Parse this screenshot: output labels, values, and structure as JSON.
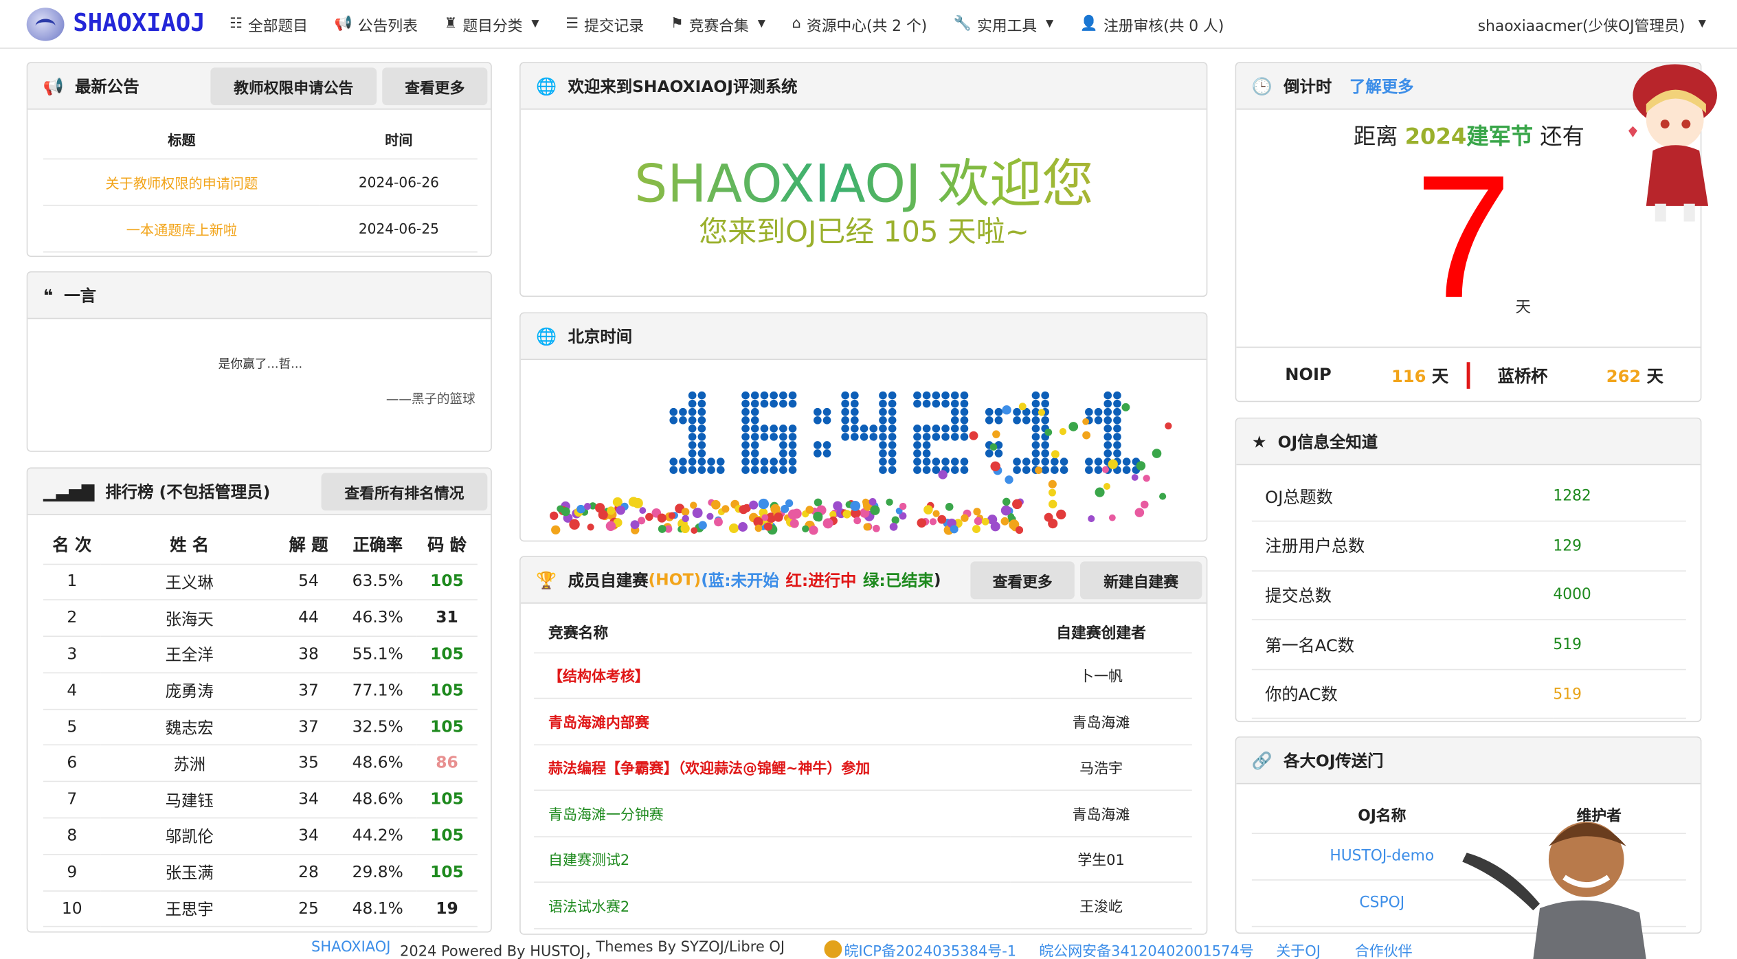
{
  "nav": {
    "logo_text": "SHAOXIAOJ",
    "items": [
      {
        "label": "全部题目",
        "icon": "list-icon",
        "dropdown": false
      },
      {
        "label": "公告列表",
        "icon": "bullhorn-icon",
        "dropdown": false
      },
      {
        "label": "题目分类",
        "icon": "bag-icon",
        "dropdown": true
      },
      {
        "label": "提交记录",
        "icon": "tasks-icon",
        "dropdown": false
      },
      {
        "label": "竞赛合集",
        "icon": "flag-icon",
        "dropdown": true
      },
      {
        "label": "资源中心(共 2 个)",
        "icon": "inbox-icon",
        "dropdown": false
      },
      {
        "label": "实用工具",
        "icon": "wrench-icon",
        "dropdown": true
      },
      {
        "label": "注册审核(共 0 人)",
        "icon": "user-icon",
        "dropdown": false
      }
    ],
    "user": "shaoxiaacmer(少侠OJ管理员)"
  },
  "announcements": {
    "title": "最新公告",
    "btn_teacher": "教师权限申请公告",
    "btn_more": "查看更多",
    "col_title": "标题",
    "col_time": "时间",
    "rows": [
      {
        "title": "关于教师权限的申请问题",
        "time": "2024-06-26"
      },
      {
        "title": "一本通题库上新啦",
        "time": "2024-06-25"
      }
    ]
  },
  "quote": {
    "title": "一言",
    "text": "是你赢了...哲...",
    "source": "——黑子的篮球"
  },
  "ranking": {
    "title": "排行榜 (不包括管理员)",
    "btn_all": "查看所有排名情况",
    "headers": [
      "名 次",
      "姓 名",
      "解 题",
      "正确率",
      "码 龄"
    ],
    "rows": [
      {
        "rank": "1",
        "name": "王义琳",
        "solved": "54",
        "rate": "63.5%",
        "age": "105",
        "age_color": "#1e8a1e"
      },
      {
        "rank": "2",
        "name": "张海天",
        "solved": "44",
        "rate": "46.3%",
        "age": "31",
        "age_color": "#222222"
      },
      {
        "rank": "3",
        "name": "王全洋",
        "solved": "38",
        "rate": "55.1%",
        "age": "105",
        "age_color": "#1e8a1e"
      },
      {
        "rank": "4",
        "name": "庞勇涛",
        "solved": "37",
        "rate": "77.1%",
        "age": "105",
        "age_color": "#1e8a1e"
      },
      {
        "rank": "5",
        "name": "魏志宏",
        "solved": "37",
        "rate": "32.5%",
        "age": "105",
        "age_color": "#1e8a1e"
      },
      {
        "rank": "6",
        "name": "苏洲",
        "solved": "35",
        "rate": "48.6%",
        "age": "86",
        "age_color": "#e89090"
      },
      {
        "rank": "7",
        "name": "马建钰",
        "solved": "34",
        "rate": "48.6%",
        "age": "105",
        "age_color": "#1e8a1e"
      },
      {
        "rank": "8",
        "name": "邬凯伦",
        "solved": "34",
        "rate": "44.2%",
        "age": "105",
        "age_color": "#1e8a1e"
      },
      {
        "rank": "9",
        "name": "张玉满",
        "solved": "28",
        "rate": "29.8%",
        "age": "105",
        "age_color": "#1e8a1e"
      },
      {
        "rank": "10",
        "name": "王思宇",
        "solved": "25",
        "rate": "48.1%",
        "age": "19",
        "age_color": "#222222"
      }
    ]
  },
  "welcome": {
    "title": "欢迎来到SHAOXIAOJ评测系统",
    "line1": "SHAOXIAOJ 欢迎您",
    "line2": "您来到OJ已经 105 天啦~"
  },
  "clock": {
    "title": "北京时间",
    "time": "16:42:11"
  },
  "contests": {
    "title_main": "成员自建赛",
    "title_hot": "(HOT)",
    "legend_open": "(",
    "legend_blue": "蓝:未开始",
    "legend_red": "红:进行中",
    "legend_green": "绿:已结束",
    "legend_close": ")",
    "btn_more": "查看更多",
    "btn_new": "新建自建赛",
    "col_name": "竞赛名称",
    "col_creator": "自建赛创建者",
    "rows": [
      {
        "name": "【结构体考核】",
        "creator": "卜一帆",
        "color": "#e01818"
      },
      {
        "name": "青岛海滩内部赛",
        "creator": "青岛海滩",
        "color": "#e01818"
      },
      {
        "name": "蒜法编程【争霸赛】（欢迎蒜法@锦鲤~神牛）参加",
        "creator": "马浩宇",
        "color": "#e01818"
      },
      {
        "name": "青岛海滩一分钟赛",
        "creator": "青岛海滩",
        "color": "#1e8a1e"
      },
      {
        "name": "自建赛测试2",
        "creator": "学生01",
        "color": "#1e8a1e"
      },
      {
        "name": "语法试水赛2",
        "creator": "王浚屹",
        "color": "#1e8a1e"
      }
    ]
  },
  "countdown": {
    "title": "倒计时",
    "learn_more": "了解更多",
    "prefix": "距离",
    "event_year": "2024",
    "event_name": "建军节",
    "suffix": "还有",
    "days": "7",
    "unit": "天",
    "noip_label": "NOIP",
    "noip_days": "116",
    "lanqiao_label": "蓝桥杯",
    "lanqiao_days": "262",
    "day_word": "天"
  },
  "info": {
    "title": "OJ信息全知道",
    "rows": [
      {
        "label": "OJ总题数",
        "value": "1282",
        "color": "#1e8a1e"
      },
      {
        "label": "注册用户总数",
        "value": "129",
        "color": "#1e8a1e"
      },
      {
        "label": "提交总数",
        "value": "4000",
        "color": "#1e8a1e"
      },
      {
        "label": "第一名AC数",
        "value": "519",
        "color": "#1e8a1e"
      },
      {
        "label": "你的AC数",
        "value": "519",
        "color": "#e8a317"
      }
    ]
  },
  "portal": {
    "title": "各大OJ传送门",
    "col_name": "OJ名称",
    "col_maint": "维护者",
    "rows": [
      {
        "name": "HUSTOJ-demo"
      },
      {
        "name": "CSPOJ"
      }
    ]
  },
  "footer": {
    "brand": "SHAOXIAOJ",
    "powered": "2024 Powered By HUSTOJ，",
    "themes": "Themes By SYZOJ/Libre OJ",
    "icp": "皖ICP备2024035384号-1",
    "police": "皖公网安备34120402001574号",
    "about": "关于OJ",
    "partners": "合作伙伴"
  },
  "colors": {
    "accent_blue": "#3d8ee8",
    "brand_blue": "#2326d8",
    "red": "#ff0000",
    "green": "#1e8a1e",
    "orange": "#f2a41a"
  }
}
